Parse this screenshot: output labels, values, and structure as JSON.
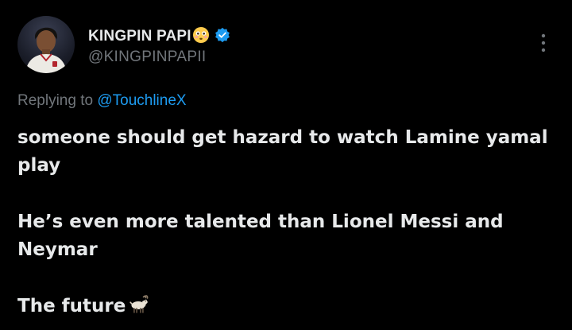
{
  "tweet": {
    "display_name": "KINGPIN PAPI",
    "name_emoji_icon": "flushed-face-icon",
    "verified_icon": "verified-badge-icon",
    "handle": "@KINGPINPAPII",
    "replying_prefix": "Replying to",
    "replying_mention": "@TouchlineX",
    "paragraphs": [
      "someone should get hazard to watch Lamine yamal play",
      "He’s even more talented than Lionel Messi and Neymar",
      "The future"
    ],
    "trailing_emoji_icon": "goat-icon"
  },
  "colors": {
    "background": "#000000",
    "text_primary": "#e7e9ea",
    "text_secondary": "#71767b",
    "accent": "#1d9bf0"
  }
}
